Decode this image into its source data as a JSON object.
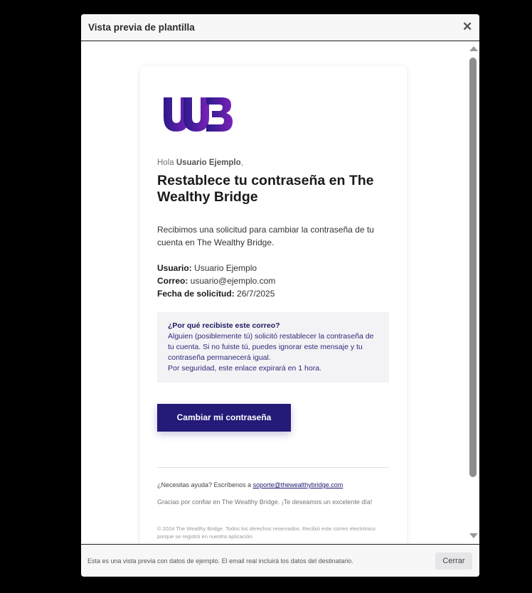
{
  "modal": {
    "title": "Vista previa de plantilla",
    "close_icon": "close-icon"
  },
  "email": {
    "logo_icon": "wb-logo",
    "greeting_prefix": "Hola ",
    "greeting_name": "Usuario Ejemplo",
    "greeting_suffix": ",",
    "headline": "Restablece tu contraseña en The Wealthy Bridge",
    "intro": "Recibimos una solicitud para cambiar la contraseña de tu cuenta en The Wealthy Bridge.",
    "details": [
      {
        "label": "Usuario:",
        "value": " Usuario Ejemplo"
      },
      {
        "label": "Correo:",
        "value": " usuario@ejemplo.com"
      },
      {
        "label": "Fecha de solicitud:",
        "value": " 26/7/2025"
      }
    ],
    "notice": {
      "title": "¿Por qué recibiste este correo?",
      "body": "Alguien (posiblemente tú) solicitó restablecer la contraseña de tu cuenta. Si no fuiste tú, puedes ignorar este mensaje y tu contraseña permanecerá igual.",
      "expiry": "Por seguridad, este enlace expirará en 1 hora."
    },
    "cta_label": "Cambiar mi contraseña",
    "help_text": "¿Necesitas ayuda? Escríbenos a ",
    "help_email": "soporte@thewealthybridge.com",
    "thanks": "Gracias por confiar en The Wealthy Bridge. ¡Te deseamos un excelente día!",
    "legal": "© 2024 The Wealthy Bridge. Todos los derechos reservados. Recibió este correo electrónico porque se registró en nuestra aplicación."
  },
  "footer": {
    "note": "Esta es una vista previa con datos de ejemplo. El email real incluirá los datos del destinatario.",
    "close_label": "Cerrar"
  },
  "colors": {
    "brand_dark": "#241a78",
    "logo_gradient_start": "#2a1a8a",
    "logo_gradient_end": "#7a22b8"
  }
}
